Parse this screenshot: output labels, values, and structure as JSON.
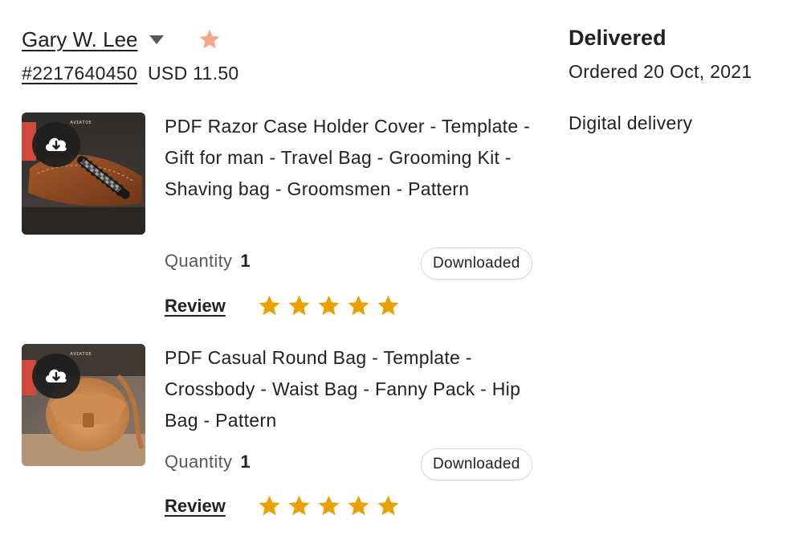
{
  "order": {
    "buyer_name": "Gary W. Lee",
    "order_id": "#2217640450",
    "total": "USD 11.50",
    "status": "Delivered",
    "ordered_date": "Ordered 20 Oct, 2021",
    "delivery_method": "Digital delivery"
  },
  "items": [
    {
      "title": "PDF Razor Case Holder Cover - Template - Gift for man - Travel Bag - Grooming Kit - Shaving bag - Groomsmen - Pattern",
      "quantity_label": "Quantity",
      "quantity": "1",
      "download_status": "Downloaded",
      "review_label": "Review",
      "rating": 5,
      "thumbnail": "razor-case-photo"
    },
    {
      "title": "PDF Casual Round Bag - Template - Crossbody - Waist Bag - Fanny Pack - Hip Bag - Pattern",
      "quantity_label": "Quantity",
      "quantity": "1",
      "download_status": "Downloaded",
      "review_label": "Review",
      "rating": 5,
      "thumbnail": "round-bag-photo"
    }
  ],
  "icons": {
    "favorite": "star-icon",
    "dropdown": "chevron-down-icon",
    "download": "cloud-download-icon",
    "rating": "star-icon"
  },
  "colors": {
    "star_gold": "#e8a100",
    "favorite_star": "#f2a98a",
    "text": "#222222",
    "muted": "#595959"
  }
}
